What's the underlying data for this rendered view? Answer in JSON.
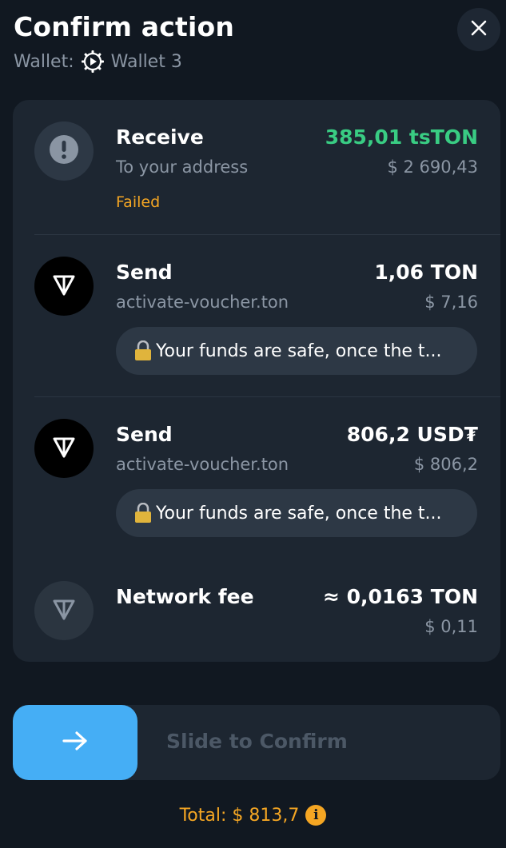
{
  "header": {
    "title": "Confirm action",
    "wallet_prefix": "Wallet:",
    "wallet_name": "Wallet 3",
    "close_icon": "close-icon"
  },
  "rows": [
    {
      "title": "Receive",
      "subtitle": "To your address",
      "status": "Failed",
      "amount": "385,01 tsTON",
      "fiat": "$ 2 690,43",
      "icon": "exclamation-icon",
      "amount_color": "#39cc83"
    },
    {
      "title": "Send",
      "subtitle": "activate-voucher.ton",
      "amount": "1,06 TON",
      "fiat": "$ 7,16",
      "comment": "Your funds are safe, once the t...",
      "icon": "ton-icon"
    },
    {
      "title": "Send",
      "subtitle": "activate-voucher.ton",
      "amount": "806,2 USD₮",
      "fiat": "$ 806,2",
      "comment": "Your funds are safe, once the t...",
      "icon": "ton-icon"
    },
    {
      "title": "Network fee",
      "amount": "≈ 0,0163 TON",
      "fiat": "$ 0,11",
      "icon": "ton-icon"
    }
  ],
  "slider": {
    "label": "Slide to Confirm",
    "icon": "arrow-right-icon"
  },
  "footer": {
    "total": "Total: $ 813,7",
    "info_icon": "info-icon"
  },
  "colors": {
    "background": "#111821",
    "card": "#1d2631",
    "accent": "#45aef5",
    "success": "#39cc83",
    "warning": "#f5a623"
  }
}
